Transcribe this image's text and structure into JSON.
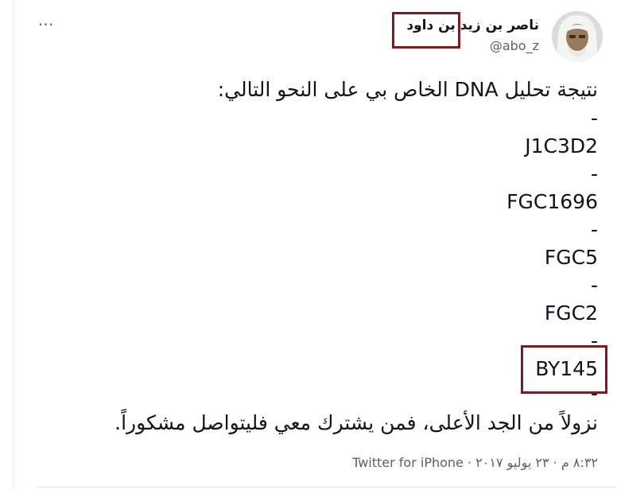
{
  "tweet": {
    "author": {
      "display_name": "ناصر بن زيد بن داود",
      "handle": "@abo_z"
    },
    "more_icon": "more-horizontal-icon",
    "lines": [
      "نتيجة تحليل DNA الخاص بي على النحو التالي:",
      "-",
      "J1C3D2",
      "-",
      "FGC1696",
      "-",
      "FGC5",
      "-",
      "FGC2",
      "-",
      "BY145",
      "-",
      "نزولاً من الجد الأعلى، فمن يشترك معي فليتواصل مشكوراً."
    ],
    "timestamp": "٨:٣٢ م · ٢٣ يوليو ٢٠١٧",
    "source": "Twitter for iPhone"
  },
  "annotations": {
    "highlight_color": "#7b1c24"
  }
}
